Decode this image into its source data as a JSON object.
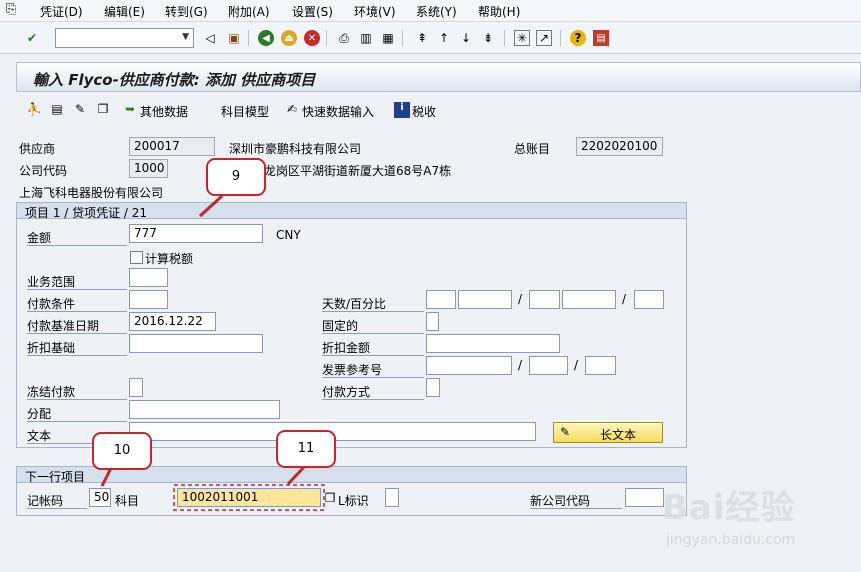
{
  "menu": {
    "items": [
      "凭证(D)",
      "编辑(E)",
      "转到(G)",
      "附加(A)",
      "设置(S)",
      "环境(V)",
      "系统(Y)",
      "帮助(H)"
    ]
  },
  "toolbar": {
    "command_value": "",
    "icons": [
      "enter-icon",
      "back-icon",
      "save-icon",
      "back-nav-icon",
      "exit-icon",
      "cancel-icon",
      "print-icon",
      "find-icon",
      "find-next-icon",
      "first-page-icon",
      "prev-page-icon",
      "next-page-icon",
      "last-page-icon",
      "new-session-icon",
      "shortcut-icon",
      "help-icon",
      "layout-icon"
    ]
  },
  "title": "輸入 Flyco-供应商付款: 添加 供应商项目",
  "app_toolbar": {
    "other_data": "其他数据",
    "account_model": "科目模型",
    "fast_entry": "快速数据输入",
    "tax": "税收"
  },
  "header": {
    "vendor_label": "供应商",
    "vendor_value": "200017",
    "vendor_name": "深圳市豪鹏科技有限公司",
    "gl_label": "总账目",
    "gl_value": "2202020100",
    "company_code_label": "公司代码",
    "company_code_value": "1000",
    "address": "龙岗区平湖街道新厦大道68号A7栋",
    "company_name": "上海飞科电器股份有限公司"
  },
  "item_section": {
    "title": "项目 1 / 贷项凭证 / 21",
    "amount_label": "金额",
    "amount_value": "777",
    "currency": "CNY",
    "calc_tax_label": "计算税额",
    "business_area_label": "业务范围",
    "payment_terms_label": "付款条件",
    "days_pct_label": "天数/百分比",
    "baseline_date_label": "付款基准日期",
    "baseline_date_value": "2016.12.22",
    "fixed_label": "固定的",
    "discount_base_label": "折扣基础",
    "discount_amount_label": "折扣金额",
    "invoice_ref_label": "发票参考号",
    "payment_block_label": "冻结付款",
    "payment_method_label": "付款方式",
    "assignment_label": "分配",
    "text_label": "文本",
    "long_text_button": "长文本",
    "slash": "/"
  },
  "next_item": {
    "title": "下一行项目",
    "posting_key_label": "记帐码",
    "posting_key_value": "50",
    "account_label": "科目",
    "account_value": "1002011001",
    "sgl_label": "L标识",
    "new_company_label": "新公司代码"
  },
  "annotations": {
    "b9": "9",
    "b10": "10",
    "b11": "11"
  },
  "watermark": {
    "brand": "Bai经验",
    "url": "jingyan.baidu.com"
  },
  "colors": {
    "annotation_red": "#c1272d",
    "highlight": "#ffe69a",
    "long_text_button": "#f5dc5a"
  }
}
